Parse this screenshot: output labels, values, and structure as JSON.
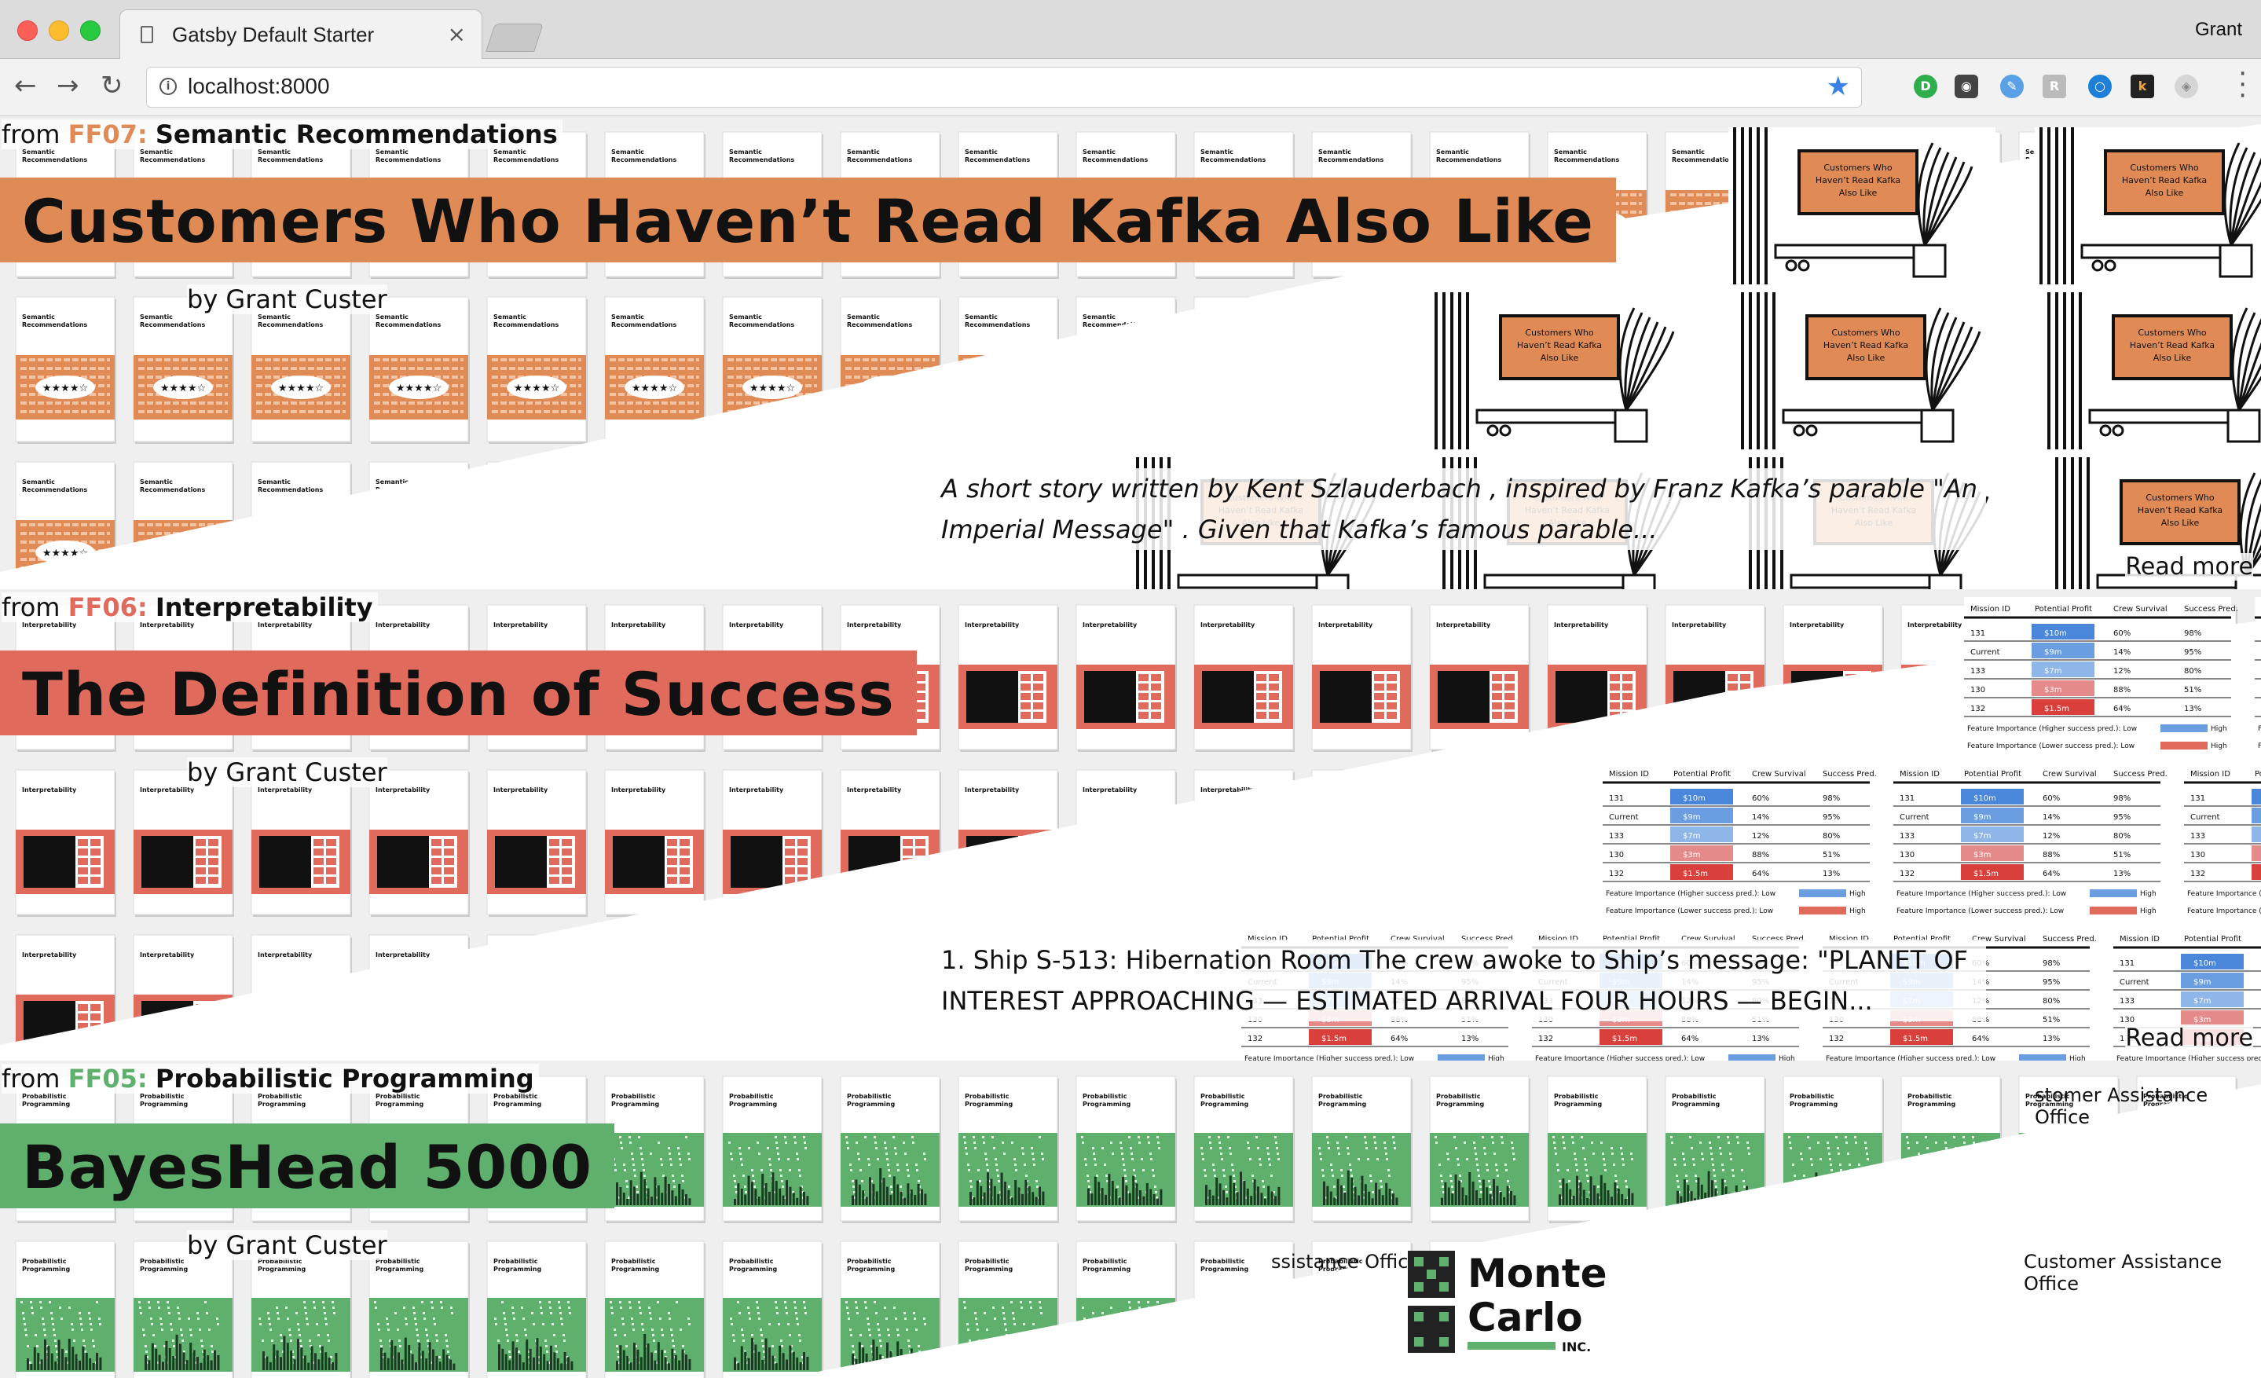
{
  "browser": {
    "tab_title": "Gatsby Default Starter",
    "tab_close": "×",
    "user": "Grant",
    "url": "localhost:8000"
  },
  "colors": {
    "ff07": "#e08a55",
    "ff06": "#e06b5d",
    "ff05": "#5fb06d",
    "chrome_bg": "#dcdcdc",
    "toolbar_bg": "#f2f2f2"
  },
  "sections": [
    {
      "from_prefix": "from ",
      "code": "FF07:",
      "topic": "Semantic Recommendations",
      "title": "Customers Who Haven’t Read Kafka Also Like",
      "byline": "by Grant Custer",
      "excerpt": "A short story written by Kent Szlauderbach , inspired by Franz Kafka’s parable \"An Imperial Message\" . Given that Kafka’s famous parable...",
      "read_more": "Read more",
      "thumb_heading": "Semantic Recommendations",
      "rating_text": "★★★★☆",
      "scene_text": "Customers Who Haven’t Read Kafka Also Like"
    },
    {
      "from_prefix": "from ",
      "code": "FF06:",
      "topic": "Interpretability",
      "title": "The Definition of Success",
      "byline": "by Grant Custer",
      "excerpt": "1. Ship S-513: Hibernation Room The crew awoke to Ship’s message: \"PLANET OF INTEREST APPROACHING — ESTIMATED ARRIVAL FOUR HOURS — BEGIN...",
      "read_more": "Read more",
      "thumb_heading": "Interpretability",
      "table_headers": [
        "Mission ID",
        "Potential Profit",
        "Crew Survival",
        "Success Pred."
      ],
      "table_rows": [
        [
          "131",
          "$10m",
          "60%",
          "98%"
        ],
        [
          "Current",
          "$9m",
          "14%",
          "95%"
        ],
        [
          "133",
          "$7m",
          "12%",
          "80%"
        ],
        [
          "130",
          "$3m",
          "88%",
          "51%"
        ],
        [
          "132",
          "$1.5m",
          "64%",
          "13%"
        ]
      ],
      "legend_higher": "Feature Importance (Higher success pred.):",
      "legend_lower": "Feature Importance (Lower success pred.):",
      "legend_low": "Low",
      "legend_high": "High"
    },
    {
      "from_prefix": "from ",
      "code": "FF05:",
      "topic": "Probabilistic Programming",
      "title": "BayesHead 5000",
      "byline": "by Grant Custer",
      "thumb_heading": "Probabilistic Programming",
      "customer_office": "Customer Assistance Office",
      "customer_office_partial": "stomer Assistance Office",
      "customer_office_partial2": "ssistance Office",
      "logo_line1": "Monte",
      "logo_line2": "Carlo",
      "logo_inc": "INC."
    }
  ]
}
